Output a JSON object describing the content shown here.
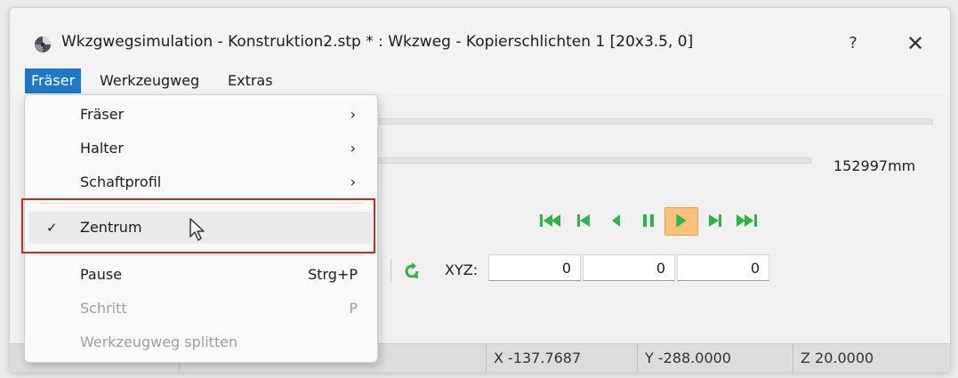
{
  "window": {
    "title": "Wkzgwegsimulation - Konstruktion2.stp * : Wkzweg - Kopierschlichten 1 [20x3.5, 0]",
    "help_label": "?",
    "close_label": "✕"
  },
  "menubar": {
    "items": [
      {
        "label": "Fräser",
        "active": true
      },
      {
        "label": "Werkzeugweg",
        "active": false
      },
      {
        "label": "Extras",
        "active": false
      }
    ]
  },
  "dropdown": {
    "items": [
      {
        "label": "Fräser",
        "submenu": "›"
      },
      {
        "label": "Halter",
        "submenu": "›"
      },
      {
        "label": "Schaftprofil",
        "submenu": "›"
      },
      {
        "label": "Zentrum",
        "checked": true,
        "check_mark": "✓"
      },
      {
        "label": "Pause",
        "shortcut": "Strg+P"
      },
      {
        "label": "Schritt",
        "shortcut": "P",
        "disabled": true
      },
      {
        "label": "Werkzeugweg splitten",
        "disabled": true
      }
    ]
  },
  "content": {
    "length_value": "152997mm",
    "xyz_label": "XYZ:",
    "xyz": [
      "0",
      "0",
      "0"
    ],
    "player_controls": [
      "go-first",
      "step-back",
      "play-reverse",
      "pause",
      "play",
      "step-forward",
      "go-last"
    ],
    "active_control": "play"
  },
  "status": {
    "x": "X  -137.7687",
    "y": "Y  -288.0000",
    "z": "Z  20.0000"
  },
  "colors": {
    "accent": "#1e78c6",
    "player_green": "#2fb24a",
    "highlight_red": "#c62828"
  }
}
